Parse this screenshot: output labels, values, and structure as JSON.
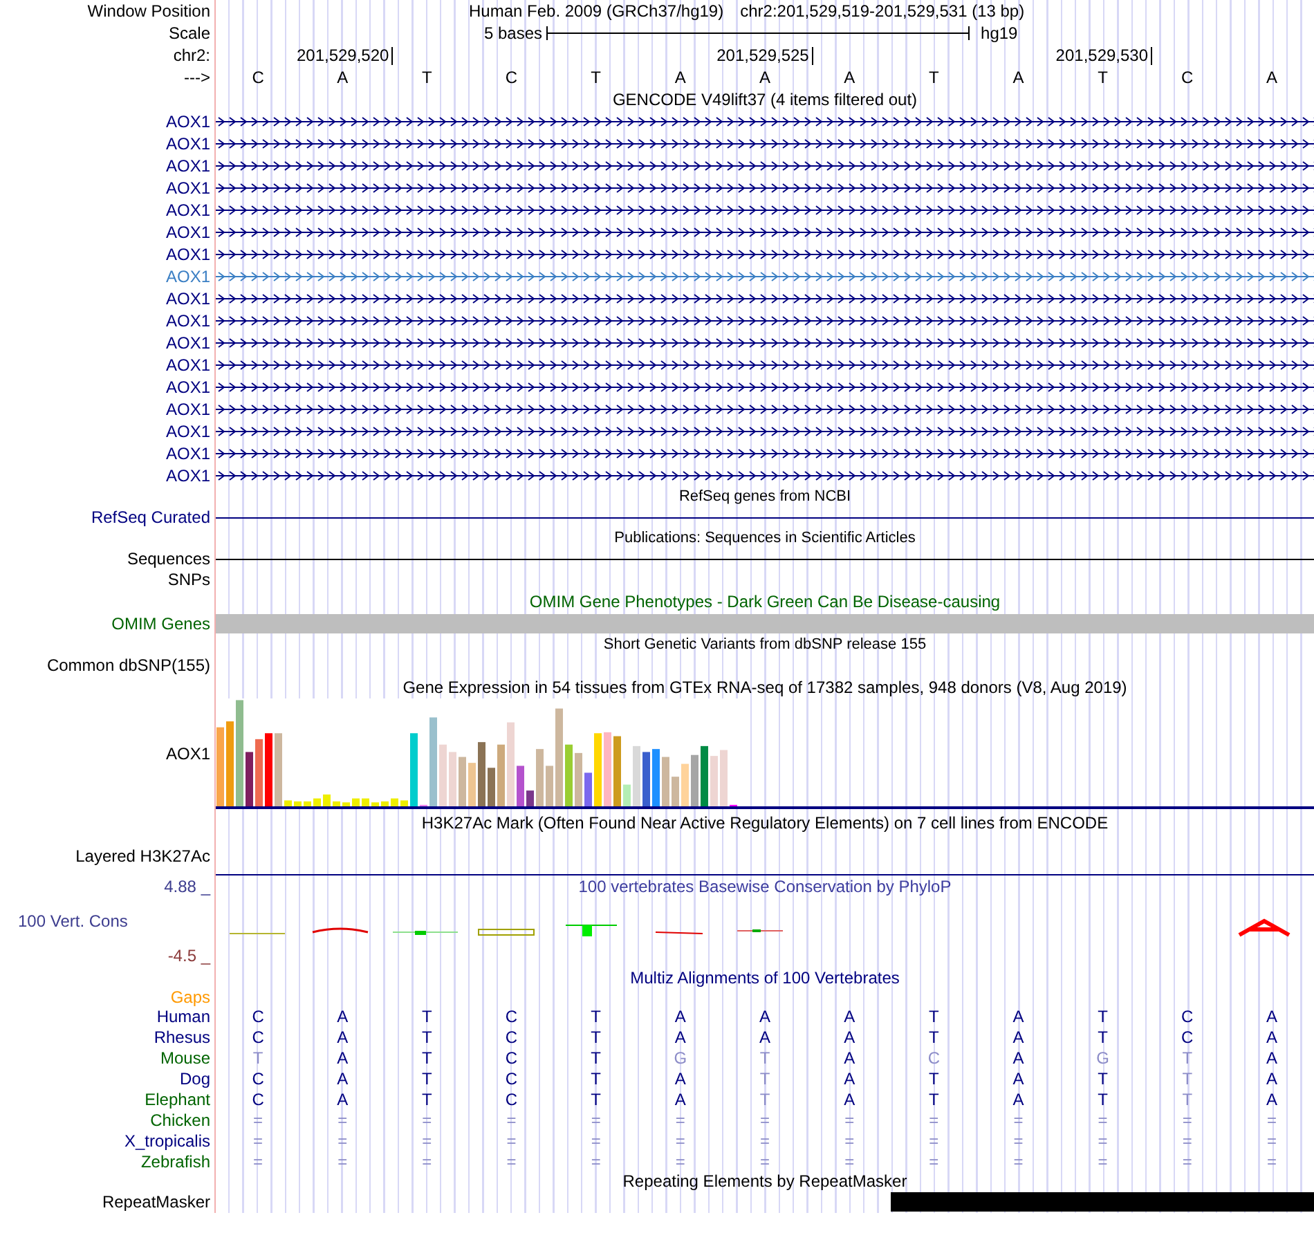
{
  "header": {
    "window_position_label": "Window Position",
    "assembly": "Human Feb. 2009 (GRCh37/hg19)",
    "position": "chr2:201,529,519-201,529,531 (13 bp)",
    "scale_label": "Scale",
    "scale_text": "5 bases",
    "scale_db": "hg19",
    "chrom_label": "chr2:",
    "strand_label": "--->",
    "bases": [
      {
        "base": "C"
      },
      {
        "base": "A",
        "coordinate": "201,529,520"
      },
      {
        "base": "T"
      },
      {
        "base": "C"
      },
      {
        "base": "T"
      },
      {
        "base": "A"
      },
      {
        "base": "A",
        "coordinate": "201,529,525"
      },
      {
        "base": "A"
      },
      {
        "base": "T"
      },
      {
        "base": "A"
      },
      {
        "base": "T",
        "coordinate": "201,529,530"
      },
      {
        "base": "C"
      },
      {
        "base": "A"
      }
    ]
  },
  "tracks": [
    {
      "kind": "genes",
      "title": "GENCODE V49lift37 (4 items filtered out)",
      "rows": [
        {
          "label": "AOX1",
          "highlighted": false
        },
        {
          "label": "AOX1",
          "highlighted": false
        },
        {
          "label": "AOX1",
          "highlighted": false
        },
        {
          "label": "AOX1",
          "highlighted": false
        },
        {
          "label": "AOX1",
          "highlighted": false
        },
        {
          "label": "AOX1",
          "highlighted": false
        },
        {
          "label": "AOX1",
          "highlighted": false
        },
        {
          "label": "AOX1",
          "highlighted": true
        },
        {
          "label": "AOX1",
          "highlighted": false
        },
        {
          "label": "AOX1",
          "highlighted": false
        },
        {
          "label": "AOX1",
          "highlighted": false
        },
        {
          "label": "AOX1",
          "highlighted": false
        },
        {
          "label": "AOX1",
          "highlighted": false
        },
        {
          "label": "AOX1",
          "highlighted": false
        },
        {
          "label": "AOX1",
          "highlighted": false
        },
        {
          "label": "AOX1",
          "highlighted": false
        },
        {
          "label": "AOX1",
          "highlighted": false
        }
      ]
    },
    {
      "kind": "line",
      "title": "RefSeq genes from NCBI",
      "label": "RefSeq Curated",
      "color": "#000080"
    },
    {
      "kind": "line",
      "title": "Publications: Sequences in Scientific Articles",
      "label": "Sequences",
      "color": "#000000"
    },
    {
      "kind": "empty",
      "label": "SNPs"
    },
    {
      "kind": "block",
      "title": "OMIM Gene Phenotypes - Dark Green Can Be Disease-causing",
      "label": "OMIM Genes",
      "color": "#006400"
    },
    {
      "kind": "empty",
      "title": "Short Genetic Variants from dbSNP release 155",
      "label": "Common dbSNP(155)"
    },
    {
      "kind": "gtex",
      "title": "Gene Expression in 54 tissues from GTEx RNA-seq of 17382 samples, 948 donors (V8, Aug 2019)",
      "label": "AOX1"
    },
    {
      "kind": "h3k27ac",
      "title": "H3K27Ac Mark (Often Found Near Active Regulatory Elements) on 7 cell lines from ENCODE",
      "label": "Layered H3K27Ac"
    },
    {
      "kind": "conservation",
      "title": "100 vertebrates Basewise Conservation by PhyloP",
      "label": "100 Vert. Cons",
      "ymax": "4.88 _",
      "ymin": "-4.5 _"
    },
    {
      "kind": "multiz",
      "title": "Multiz Alignments of 100 Vertebrates",
      "gaps_label": "Gaps",
      "species": [
        {
          "name": "Human",
          "color": "#000080",
          "bases": [
            {
              "b": "C",
              "faded": false
            },
            {
              "b": "A",
              "faded": false
            },
            {
              "b": "T",
              "faded": false
            },
            {
              "b": "C",
              "faded": false
            },
            {
              "b": "T",
              "faded": false
            },
            {
              "b": "A",
              "faded": false
            },
            {
              "b": "A",
              "faded": false
            },
            {
              "b": "A",
              "faded": false
            },
            {
              "b": "T",
              "faded": false
            },
            {
              "b": "A",
              "faded": false
            },
            {
              "b": "T",
              "faded": false
            },
            {
              "b": "C",
              "faded": false
            },
            {
              "b": "A",
              "faded": false
            }
          ]
        },
        {
          "name": "Rhesus",
          "color": "#000080",
          "bases": [
            {
              "b": "C",
              "faded": false
            },
            {
              "b": "A",
              "faded": false
            },
            {
              "b": "T",
              "faded": false
            },
            {
              "b": "C",
              "faded": false
            },
            {
              "b": "T",
              "faded": false
            },
            {
              "b": "A",
              "faded": false
            },
            {
              "b": "A",
              "faded": false
            },
            {
              "b": "A",
              "faded": false
            },
            {
              "b": "T",
              "faded": false
            },
            {
              "b": "A",
              "faded": false
            },
            {
              "b": "T",
              "faded": false
            },
            {
              "b": "C",
              "faded": false
            },
            {
              "b": "A",
              "faded": false
            }
          ]
        },
        {
          "name": "Mouse",
          "color": "#006400",
          "bases": [
            {
              "b": "T",
              "faded": true
            },
            {
              "b": "A",
              "faded": false
            },
            {
              "b": "T",
              "faded": false
            },
            {
              "b": "C",
              "faded": false
            },
            {
              "b": "T",
              "faded": false
            },
            {
              "b": "G",
              "faded": true
            },
            {
              "b": "T",
              "faded": true
            },
            {
              "b": "A",
              "faded": false
            },
            {
              "b": "C",
              "faded": true
            },
            {
              "b": "A",
              "faded": false
            },
            {
              "b": "G",
              "faded": true
            },
            {
              "b": "T",
              "faded": true
            },
            {
              "b": "A",
              "faded": false
            }
          ]
        },
        {
          "name": "Dog",
          "color": "#000080",
          "bases": [
            {
              "b": "C",
              "faded": false
            },
            {
              "b": "A",
              "faded": false
            },
            {
              "b": "T",
              "faded": false
            },
            {
              "b": "C",
              "faded": false
            },
            {
              "b": "T",
              "faded": false
            },
            {
              "b": "A",
              "faded": false
            },
            {
              "b": "T",
              "faded": true
            },
            {
              "b": "A",
              "faded": false
            },
            {
              "b": "T",
              "faded": false
            },
            {
              "b": "A",
              "faded": false
            },
            {
              "b": "T",
              "faded": false
            },
            {
              "b": "T",
              "faded": true
            },
            {
              "b": "A",
              "faded": false
            }
          ]
        },
        {
          "name": "Elephant",
          "color": "#006400",
          "bases": [
            {
              "b": "C",
              "faded": false
            },
            {
              "b": "A",
              "faded": false
            },
            {
              "b": "T",
              "faded": false
            },
            {
              "b": "C",
              "faded": false
            },
            {
              "b": "T",
              "faded": false
            },
            {
              "b": "A",
              "faded": false
            },
            {
              "b": "T",
              "faded": true
            },
            {
              "b": "A",
              "faded": false
            },
            {
              "b": "T",
              "faded": false
            },
            {
              "b": "A",
              "faded": false
            },
            {
              "b": "T",
              "faded": false
            },
            {
              "b": "T",
              "faded": true
            },
            {
              "b": "A",
              "faded": false
            }
          ]
        },
        {
          "name": "Chicken",
          "color": "#006400",
          "bases": [
            {
              "b": "=",
              "faded": true
            },
            {
              "b": "=",
              "faded": true
            },
            {
              "b": "=",
              "faded": true
            },
            {
              "b": "=",
              "faded": true
            },
            {
              "b": "=",
              "faded": true
            },
            {
              "b": "=",
              "faded": true
            },
            {
              "b": "=",
              "faded": true
            },
            {
              "b": "=",
              "faded": true
            },
            {
              "b": "=",
              "faded": true
            },
            {
              "b": "=",
              "faded": true
            },
            {
              "b": "=",
              "faded": true
            },
            {
              "b": "=",
              "faded": true
            },
            {
              "b": "=",
              "faded": true
            }
          ]
        },
        {
          "name": "X_tropicalis",
          "color": "#000080",
          "bases": [
            {
              "b": "=",
              "faded": true
            },
            {
              "b": "=",
              "faded": true
            },
            {
              "b": "=",
              "faded": true
            },
            {
              "b": "=",
              "faded": true
            },
            {
              "b": "=",
              "faded": true
            },
            {
              "b": "=",
              "faded": true
            },
            {
              "b": "=",
              "faded": true
            },
            {
              "b": "=",
              "faded": true
            },
            {
              "b": "=",
              "faded": true
            },
            {
              "b": "=",
              "faded": true
            },
            {
              "b": "=",
              "faded": true
            },
            {
              "b": "=",
              "faded": true
            },
            {
              "b": "=",
              "faded": true
            }
          ]
        },
        {
          "name": "Zebrafish",
          "color": "#006400",
          "bases": [
            {
              "b": "=",
              "faded": true
            },
            {
              "b": "=",
              "faded": true
            },
            {
              "b": "=",
              "faded": true
            },
            {
              "b": "=",
              "faded": true
            },
            {
              "b": "=",
              "faded": true
            },
            {
              "b": "=",
              "faded": true
            },
            {
              "b": "=",
              "faded": true
            },
            {
              "b": "=",
              "faded": true
            },
            {
              "b": "=",
              "faded": true
            },
            {
              "b": "=",
              "faded": true
            },
            {
              "b": "=",
              "faded": true
            },
            {
              "b": "=",
              "faded": true
            },
            {
              "b": "=",
              "faded": true
            }
          ]
        }
      ]
    },
    {
      "kind": "repeats",
      "title": "Repeating Elements by RepeatMasker",
      "label": "RepeatMasker"
    }
  ]
}
